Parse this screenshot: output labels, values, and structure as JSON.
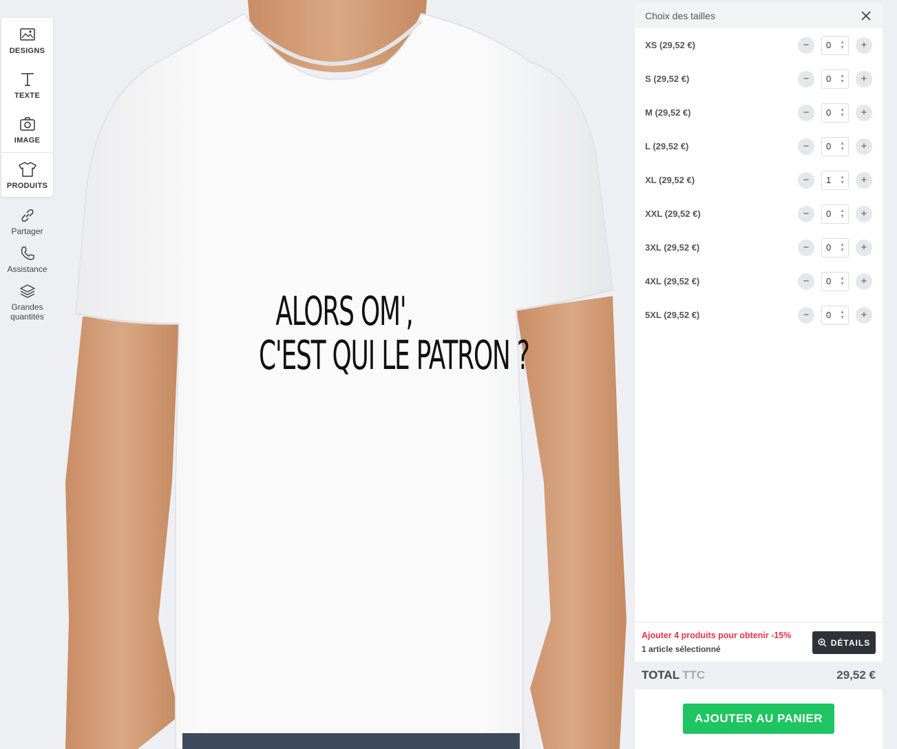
{
  "toolbar": {
    "items": [
      {
        "label": "DESIGNS",
        "icon": "image-gallery-icon"
      },
      {
        "label": "TEXTE",
        "icon": "text-icon"
      },
      {
        "label": "IMAGE",
        "icon": "camera-icon"
      },
      {
        "label": "PRODUITS",
        "icon": "tshirt-icon"
      }
    ]
  },
  "side_links": [
    {
      "label": "Partager",
      "icon": "link-icon"
    },
    {
      "label": "Assistance",
      "icon": "phone-icon"
    },
    {
      "label": "Grandes quantités",
      "icon": "layers-icon"
    }
  ],
  "design": {
    "line1": "ALORS OM',",
    "line2": "C'EST QUI LE PATRON ?"
  },
  "colors": {
    "shirt": "#ffffff",
    "skin": "#d4a07c",
    "accent_green": "#1ec560",
    "promo_red": "#e8344b",
    "details_dark": "#2f3338"
  },
  "panel": {
    "title": "Choix des tailles",
    "sizes": [
      {
        "label": "XS (29,52 €)",
        "qty": "0"
      },
      {
        "label": "S (29,52 €)",
        "qty": "0"
      },
      {
        "label": "M (29,52 €)",
        "qty": "0"
      },
      {
        "label": "L (29,52 €)",
        "qty": "0"
      },
      {
        "label": "XL (29,52 €)",
        "qty": "1"
      },
      {
        "label": "XXL (29,52 €)",
        "qty": "0"
      },
      {
        "label": "3XL (29,52 €)",
        "qty": "0"
      },
      {
        "label": "4XL (29,52 €)",
        "qty": "0"
      },
      {
        "label": "5XL (29,52 €)",
        "qty": "0"
      }
    ],
    "minus_symbol": "−",
    "plus_symbol": "+",
    "promo": "Ajouter 4 produits pour obtenir -15%",
    "selected": "1 article sélectionné",
    "details_label": "DÉTAILS",
    "total_label": "TOTAL",
    "total_suffix": "TTC",
    "total_value": "29,52 €",
    "add_to_cart": "AJOUTER AU PANIER"
  }
}
